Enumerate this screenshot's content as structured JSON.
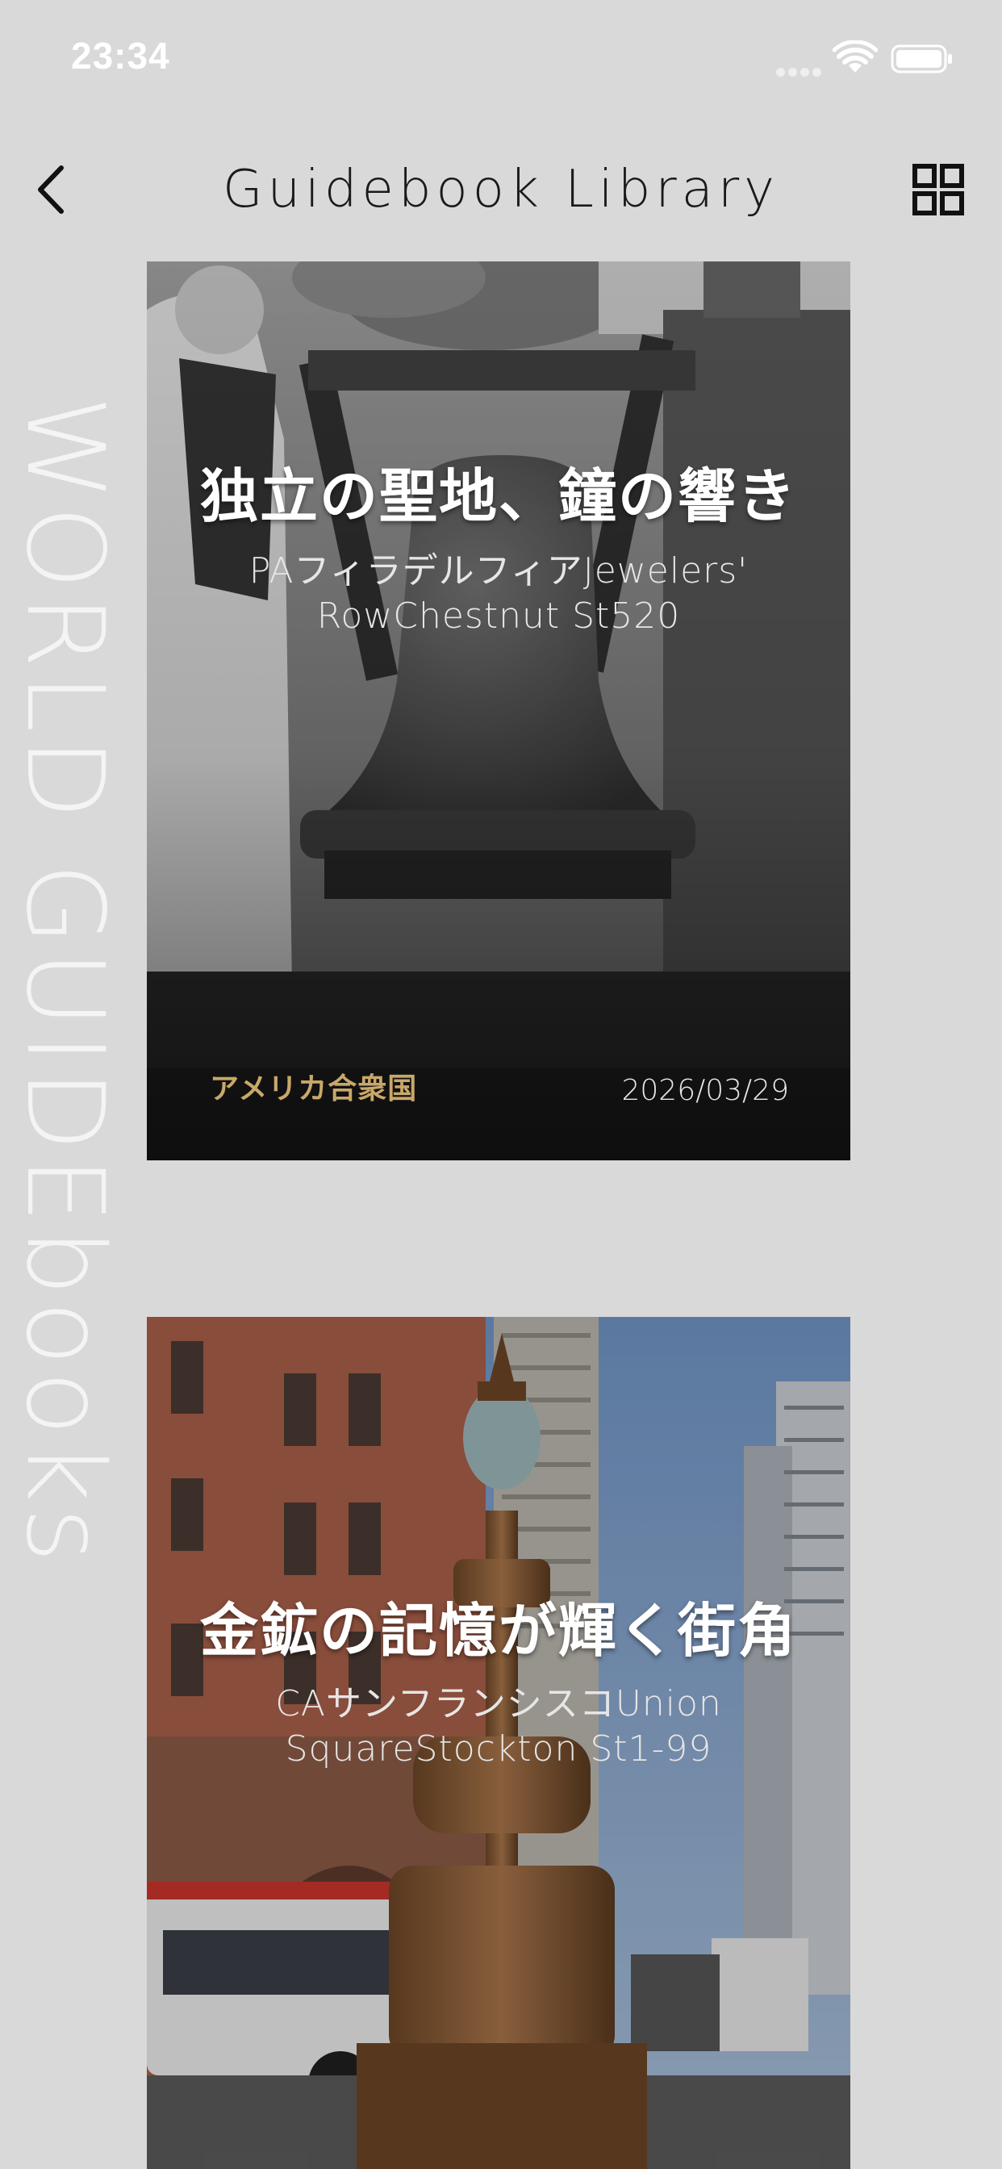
{
  "status_bar": {
    "time": "23:34",
    "icons": [
      "signal-dots-icon",
      "wifi-icon",
      "battery-icon"
    ]
  },
  "header": {
    "title": "Guidebook Library",
    "back_icon": "chevron-left-icon",
    "grid_icon": "grid-view-icon"
  },
  "watermark": "WORLD GUIDEbooks",
  "colors": {
    "background": "#d9d9d9",
    "country_accent": "#c8a86a",
    "watermark": "#f4f4f4"
  },
  "guidebooks": [
    {
      "title": "独立の聖地、鐘の響き",
      "subtitle_line1": "PAフィラデルフィアJewelers'",
      "subtitle_line2": "RowChestnut St520",
      "country": "アメリカ合衆国",
      "date": "2026/03/29"
    },
    {
      "title": "金鉱の記憶が輝く街角",
      "subtitle_line1": "CAサンフランシスコUnion",
      "subtitle_line2": "SquareStockton St1-99"
    }
  ]
}
